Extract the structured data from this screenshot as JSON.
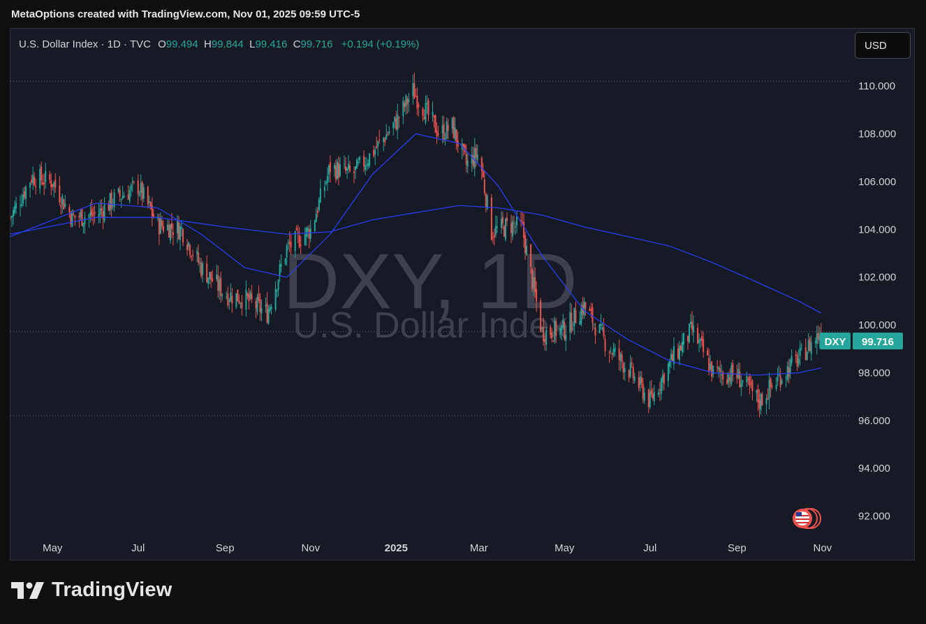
{
  "caption": "MetaOptions created with TradingView.com, Nov 01, 2025 09:59 UTC-5",
  "legend": {
    "symbol_desc": "U.S. Dollar Index · 1D · TVC",
    "open_label": "O",
    "open_value": "99.494",
    "high_label": "H",
    "high_value": "99.844",
    "low_label": "L",
    "low_value": "99.416",
    "close_label": "C",
    "close_value": "99.716",
    "change": "+0.194 (+0.19%)"
  },
  "currency_button": "USD",
  "watermark": {
    "line1": "DXY, 1D",
    "line2": "U.S. Dollar Index"
  },
  "price_tag": {
    "symbol": "DXY",
    "value": "99.716"
  },
  "brand": "TradingView",
  "colors": {
    "up": "#26a69a",
    "down": "#ef5350",
    "ma": "#2b3cf0",
    "background": "#161a25",
    "grid_dotted": "#6b6f7a"
  },
  "chart_data": {
    "type": "candlestick",
    "y_range": [
      91.2,
      112.4
    ],
    "x_range": [
      "2024-04-01",
      "2025-11-20"
    ],
    "y_ticks": [
      "110.000",
      "108.000",
      "106.000",
      "104.000",
      "102.000",
      "100.000",
      "98.000",
      "96.000",
      "94.000",
      "92.000"
    ],
    "x_ticks": [
      {
        "label": "May",
        "date": "2024-05-01",
        "bold": false
      },
      {
        "label": "Jul",
        "date": "2024-07-01",
        "bold": false
      },
      {
        "label": "Sep",
        "date": "2024-09-01",
        "bold": false
      },
      {
        "label": "Nov",
        "date": "2024-11-01",
        "bold": false
      },
      {
        "label": "2025",
        "date": "2025-01-01",
        "bold": true
      },
      {
        "label": "Mar",
        "date": "2025-03-01",
        "bold": false
      },
      {
        "label": "May",
        "date": "2025-05-01",
        "bold": false
      },
      {
        "label": "Jul",
        "date": "2025-07-01",
        "bold": false
      },
      {
        "label": "Sep",
        "date": "2025-09-01",
        "bold": false
      },
      {
        "label": "Nov",
        "date": "2025-11-01",
        "bold": false
      }
    ],
    "reference_lines": [
      110.2,
      99.72,
      96.2
    ],
    "last_price": 99.716,
    "close_series": [
      [
        "2024-04-01",
        104.5
      ],
      [
        "2024-04-16",
        106.2
      ],
      [
        "2024-05-01",
        106.0
      ],
      [
        "2024-05-15",
        104.5
      ],
      [
        "2024-06-01",
        104.6
      ],
      [
        "2024-06-15",
        105.3
      ],
      [
        "2024-07-01",
        105.8
      ],
      [
        "2024-07-15",
        104.2
      ],
      [
        "2024-08-01",
        104.0
      ],
      [
        "2024-08-15",
        102.4
      ],
      [
        "2024-09-01",
        101.3
      ],
      [
        "2024-09-15",
        101.1
      ],
      [
        "2024-10-01",
        100.5
      ],
      [
        "2024-10-15",
        103.2
      ],
      [
        "2024-11-01",
        104.0
      ],
      [
        "2024-11-15",
        106.6
      ],
      [
        "2024-12-01",
        106.3
      ],
      [
        "2024-12-15",
        107.2
      ],
      [
        "2025-01-01",
        108.5
      ],
      [
        "2025-01-13",
        109.8
      ],
      [
        "2025-02-01",
        108.0
      ],
      [
        "2025-02-10",
        108.3
      ],
      [
        "2025-02-20",
        106.7
      ],
      [
        "2025-03-01",
        107.2
      ],
      [
        "2025-03-10",
        103.9
      ],
      [
        "2025-03-25",
        104.2
      ],
      [
        "2025-04-01",
        104.0
      ],
      [
        "2025-04-15",
        99.7
      ],
      [
        "2025-05-01",
        99.8
      ],
      [
        "2025-05-15",
        100.8
      ],
      [
        "2025-06-01",
        99.1
      ],
      [
        "2025-06-15",
        98.2
      ],
      [
        "2025-07-01",
        96.8
      ],
      [
        "2025-07-15",
        98.4
      ],
      [
        "2025-07-31",
        99.8
      ],
      [
        "2025-08-15",
        98.0
      ],
      [
        "2025-09-01",
        97.9
      ],
      [
        "2025-09-17",
        96.8
      ],
      [
        "2025-10-01",
        97.8
      ],
      [
        "2025-10-15",
        98.6
      ],
      [
        "2025-10-31",
        99.716
      ]
    ],
    "ma_short": [
      [
        "2024-04-01",
        103.7
      ],
      [
        "2024-06-01",
        105.1
      ],
      [
        "2024-07-15",
        104.9
      ],
      [
        "2024-08-15",
        103.8
      ],
      [
        "2024-09-15",
        102.4
      ],
      [
        "2024-10-15",
        102.0
      ],
      [
        "2024-11-15",
        103.8
      ],
      [
        "2024-12-15",
        106.3
      ],
      [
        "2025-01-15",
        108.0
      ],
      [
        "2025-02-15",
        107.6
      ],
      [
        "2025-03-15",
        105.8
      ],
      [
        "2025-04-15",
        102.9
      ],
      [
        "2025-05-15",
        100.6
      ],
      [
        "2025-06-15",
        99.4
      ],
      [
        "2025-07-15",
        98.5
      ],
      [
        "2025-08-15",
        98.0
      ],
      [
        "2025-09-15",
        97.9
      ],
      [
        "2025-10-15",
        98.0
      ],
      [
        "2025-10-31",
        98.2
      ]
    ],
    "ma_long": [
      [
        "2024-04-01",
        103.8
      ],
      [
        "2024-06-01",
        104.5
      ],
      [
        "2024-07-15",
        104.5
      ],
      [
        "2024-09-01",
        104.1
      ],
      [
        "2024-10-15",
        103.8
      ],
      [
        "2024-11-15",
        103.9
      ],
      [
        "2024-12-15",
        104.4
      ],
      [
        "2025-01-15",
        104.7
      ],
      [
        "2025-02-15",
        105.0
      ],
      [
        "2025-03-15",
        104.9
      ],
      [
        "2025-04-15",
        104.6
      ],
      [
        "2025-05-15",
        104.1
      ],
      [
        "2025-06-15",
        103.7
      ],
      [
        "2025-07-15",
        103.3
      ],
      [
        "2025-08-15",
        102.6
      ],
      [
        "2025-09-15",
        101.8
      ],
      [
        "2025-10-15",
        101.0
      ],
      [
        "2025-10-31",
        100.5
      ]
    ]
  }
}
